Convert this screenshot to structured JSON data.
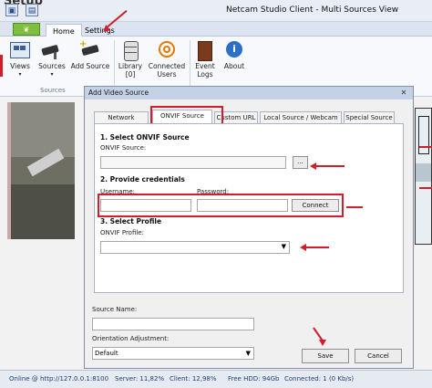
{
  "window": {
    "title": "Netcam Studio Client - Multi Sources View",
    "setup_text": "Setup"
  },
  "ribbon": {
    "tabs": [
      "Home",
      "Settings"
    ],
    "buttons": [
      {
        "label": "Views",
        "icon": "views-icon"
      },
      {
        "label": "Sources",
        "icon": "sources-icon"
      },
      {
        "label": "Add Source",
        "icon": "add-camera-icon"
      },
      {
        "label": "Library\n[0]",
        "icon": "library-icon"
      },
      {
        "label": "Connected\nUsers",
        "icon": "connected-users-icon"
      },
      {
        "label": "Event\nLogs",
        "icon": "event-logs-icon"
      },
      {
        "label": "About",
        "icon": "about-icon"
      }
    ],
    "group_sources": "Sources"
  },
  "dialog": {
    "title": "Add Video Source",
    "close": "✕",
    "tabs": [
      "Network Camera",
      "ONVIF Source",
      "Custom URL",
      "Local Source / Webcam",
      "Special Source"
    ],
    "active_tab": "ONVIF Source",
    "section1": "1. Select ONVIF Source",
    "onvif_source_label": "ONVIF Source:",
    "onvif_source_value": "",
    "browse_label": "...",
    "section2": "2. Provide credentials",
    "username_label": "Username:",
    "username_value": "",
    "password_label": "Password:",
    "password_value": "",
    "connect_label": "Connect",
    "section3": "3. Select Profile",
    "profile_label": "ONVIF Profile:",
    "profile_value": "",
    "source_name_label": "Source Name:",
    "source_name_value": "",
    "orientation_label": "Orientation Adjustment:",
    "orientation_value": "Default",
    "save_label": "Save",
    "cancel_label": "Cancel"
  },
  "status": {
    "online": "Online @ http://127.0.0.1:8100",
    "server": "Server: 11,82%",
    "client": "Client: 12,98%",
    "hdd": "Free HDD: 94Gb",
    "connected": "Connected: 1 (0 Kb/s)"
  },
  "camera_caption": "",
  "colors": {
    "highlight": "#d21e2b",
    "ribbon_bg": "#f7f9fc",
    "title_bg": "#c4d2e6"
  }
}
